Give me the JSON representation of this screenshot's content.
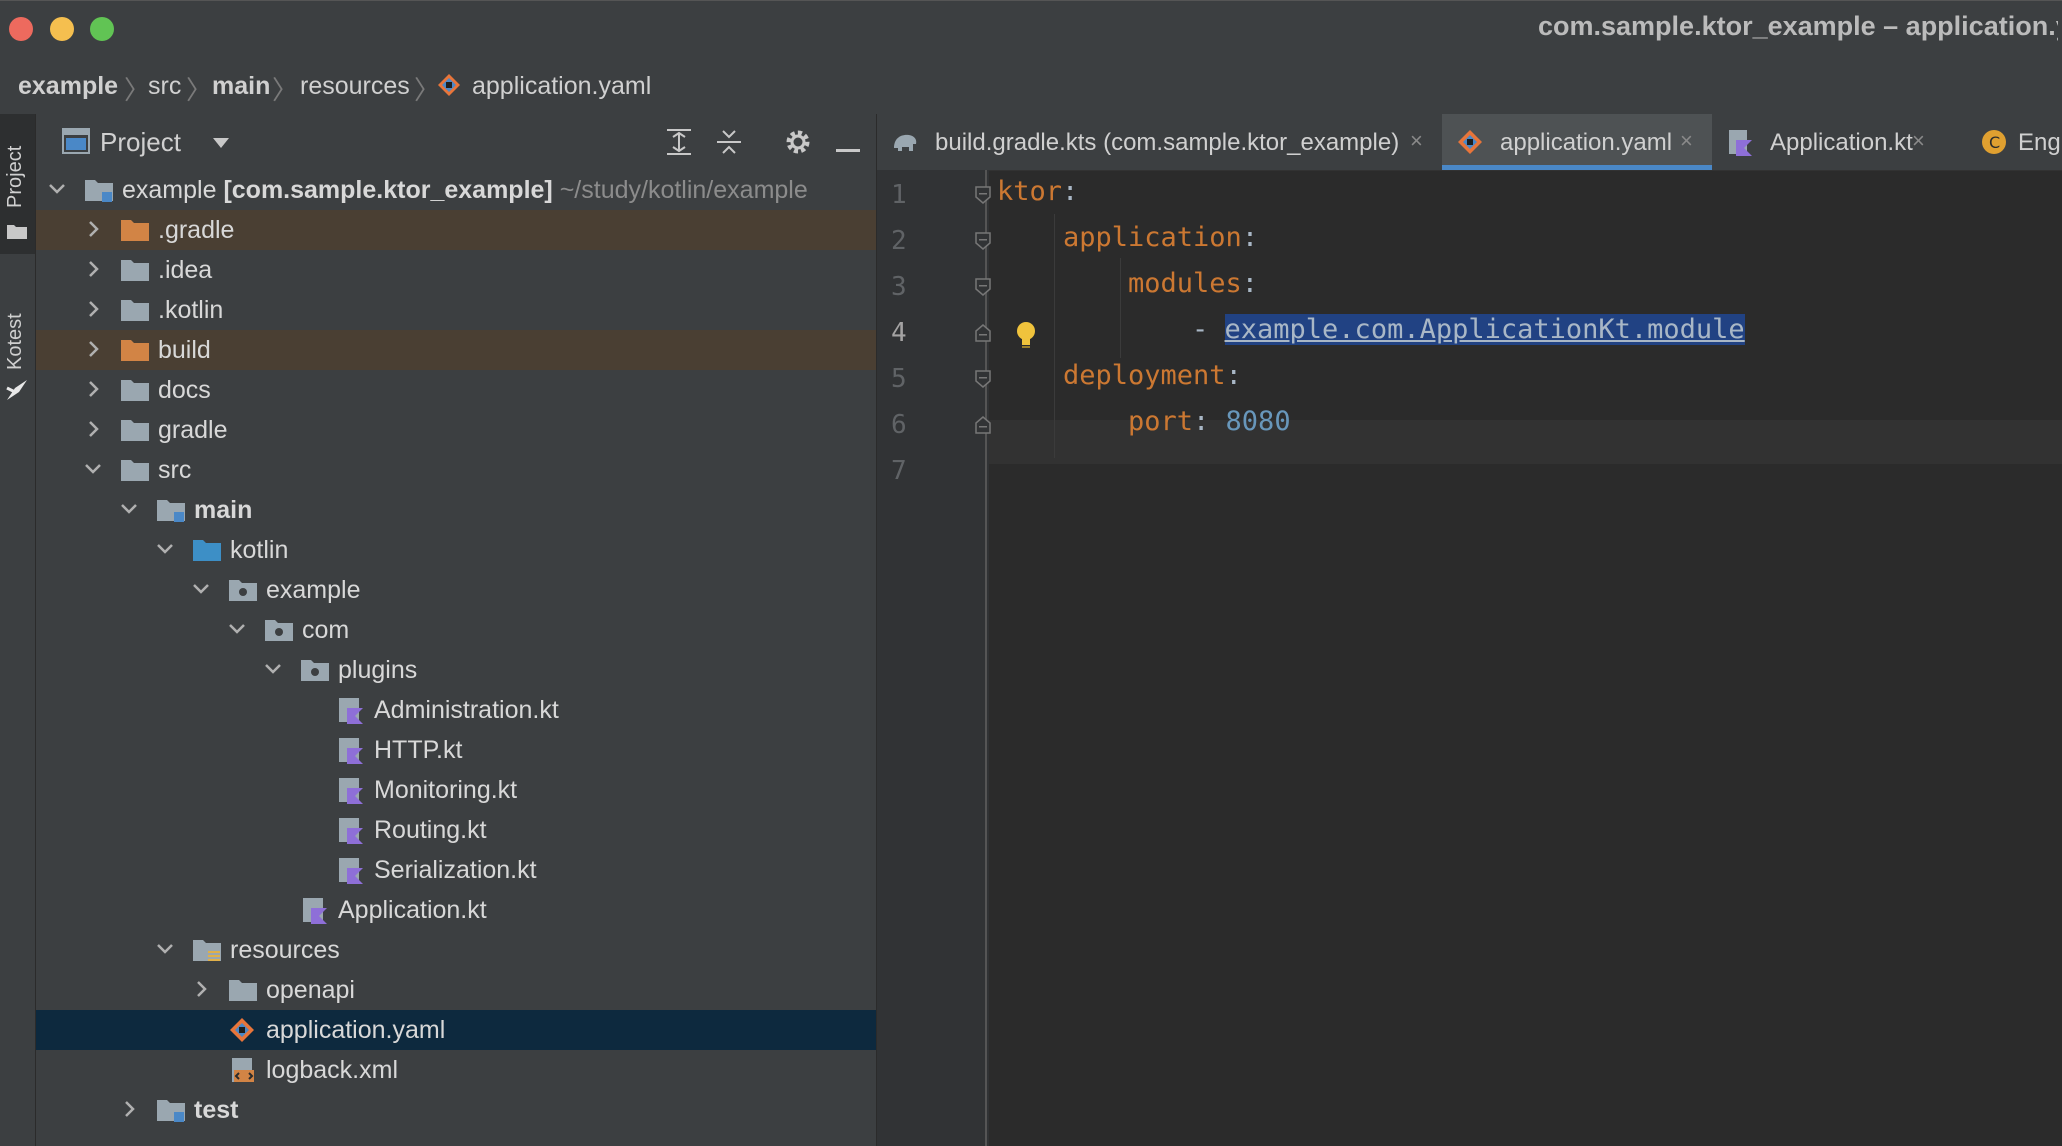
{
  "window": {
    "title": "com.sample.ktor_example – application.yaml"
  },
  "breadcrumb": {
    "items": [
      "example",
      "src",
      "main",
      "resources",
      "application.yaml"
    ]
  },
  "sidebar_tabs": {
    "project": "Project",
    "kotest": "Kotest"
  },
  "project_panel": {
    "title": "Project",
    "tree": [
      {
        "label": "example",
        "extra": "[com.sample.ktor_example]",
        "path": "~/study/kotlin/example"
      },
      {
        "label": ".gradle"
      },
      {
        "label": ".idea"
      },
      {
        "label": ".kotlin"
      },
      {
        "label": "build"
      },
      {
        "label": "docs"
      },
      {
        "label": "gradle"
      },
      {
        "label": "src"
      },
      {
        "label": "main"
      },
      {
        "label": "kotlin"
      },
      {
        "label": "example"
      },
      {
        "label": "com"
      },
      {
        "label": "plugins"
      },
      {
        "label": "Administration.kt"
      },
      {
        "label": "HTTP.kt"
      },
      {
        "label": "Monitoring.kt"
      },
      {
        "label": "Routing.kt"
      },
      {
        "label": "Serialization.kt"
      },
      {
        "label": "Application.kt"
      },
      {
        "label": "resources"
      },
      {
        "label": "openapi"
      },
      {
        "label": "application.yaml"
      },
      {
        "label": "logback.xml"
      },
      {
        "label": "test"
      }
    ]
  },
  "editor": {
    "tabs": [
      {
        "label": "build.gradle.kts (com.sample.ktor_example)",
        "close": "×",
        "icon": "gradle-elephant-icon"
      },
      {
        "label": "application.yaml",
        "close": "×",
        "icon": "yaml-icon"
      },
      {
        "label": "Application.kt",
        "close": "×",
        "icon": "kotlin-file-icon"
      },
      {
        "label": "Engi",
        "icon": "class-icon"
      }
    ],
    "line_numbers": [
      "1",
      "2",
      "3",
      "4",
      "5",
      "6",
      "7"
    ],
    "code": {
      "l1_key": "ktor",
      "l1_colon": ":",
      "l2_key": "application",
      "l2_colon": ":",
      "l3_key": "modules",
      "l3_colon": ":",
      "l4_dash": "- ",
      "l4_value": "example.com.ApplicationKt.module",
      "l5_key": "deployment",
      "l5_colon": ":",
      "l6_key": "port",
      "l6_colon": ": ",
      "l6_value": "8080"
    }
  },
  "colors": {
    "background": "#2b2b2b",
    "panel": "#3c3f41",
    "yaml_key": "#cc7832",
    "number": "#6897bb",
    "selection": "#214283",
    "tab_underline": "#4a88c7",
    "tree_selected": "#0d293e",
    "excluded_folder": "#4a3f33"
  }
}
